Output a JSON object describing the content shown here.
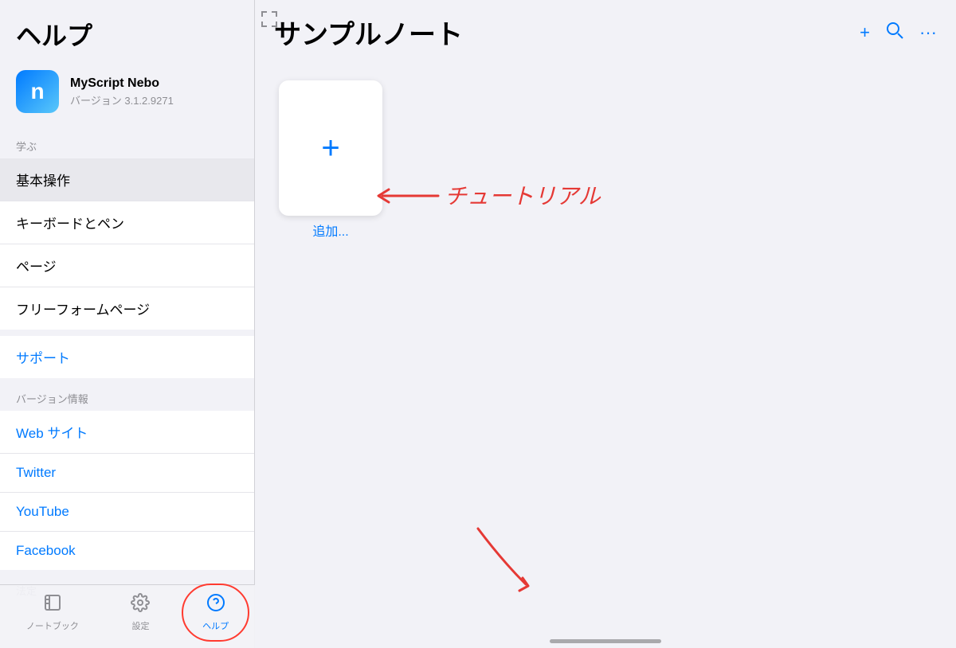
{
  "sidebar": {
    "title": "ヘルプ",
    "app": {
      "name": "MyScript Nebo",
      "version": "バージョン 3.1.2.9271"
    },
    "learn_label": "学ぶ",
    "menu_items": [
      {
        "id": "basics",
        "label": "基本操作",
        "active": true
      },
      {
        "id": "keyboard",
        "label": "キーボードとペン"
      },
      {
        "id": "page",
        "label": "ページ"
      },
      {
        "id": "freeform",
        "label": "フリーフォームページ"
      }
    ],
    "support_label": "サポート",
    "version_label": "バージョン情報",
    "links": [
      {
        "id": "web",
        "label": "Web サイト"
      },
      {
        "id": "twitter",
        "label": "Twitter"
      },
      {
        "id": "youtube",
        "label": "YouTube"
      },
      {
        "id": "facebook",
        "label": "Facebook"
      }
    ],
    "legal_label": "法定",
    "tabs": [
      {
        "id": "notebook",
        "label": "ノートブック",
        "icon": "▦"
      },
      {
        "id": "settings",
        "label": "設定",
        "icon": "⚙"
      },
      {
        "id": "help",
        "label": "ヘルプ",
        "icon": "?",
        "active": true
      }
    ]
  },
  "main": {
    "title": "サンプルノート",
    "add_label": "追加...",
    "header_buttons": [
      "+",
      "⌕",
      "···"
    ]
  },
  "annotations": {
    "tutorial_text": "← チュートリアル",
    "arrow_hint": "↓"
  }
}
